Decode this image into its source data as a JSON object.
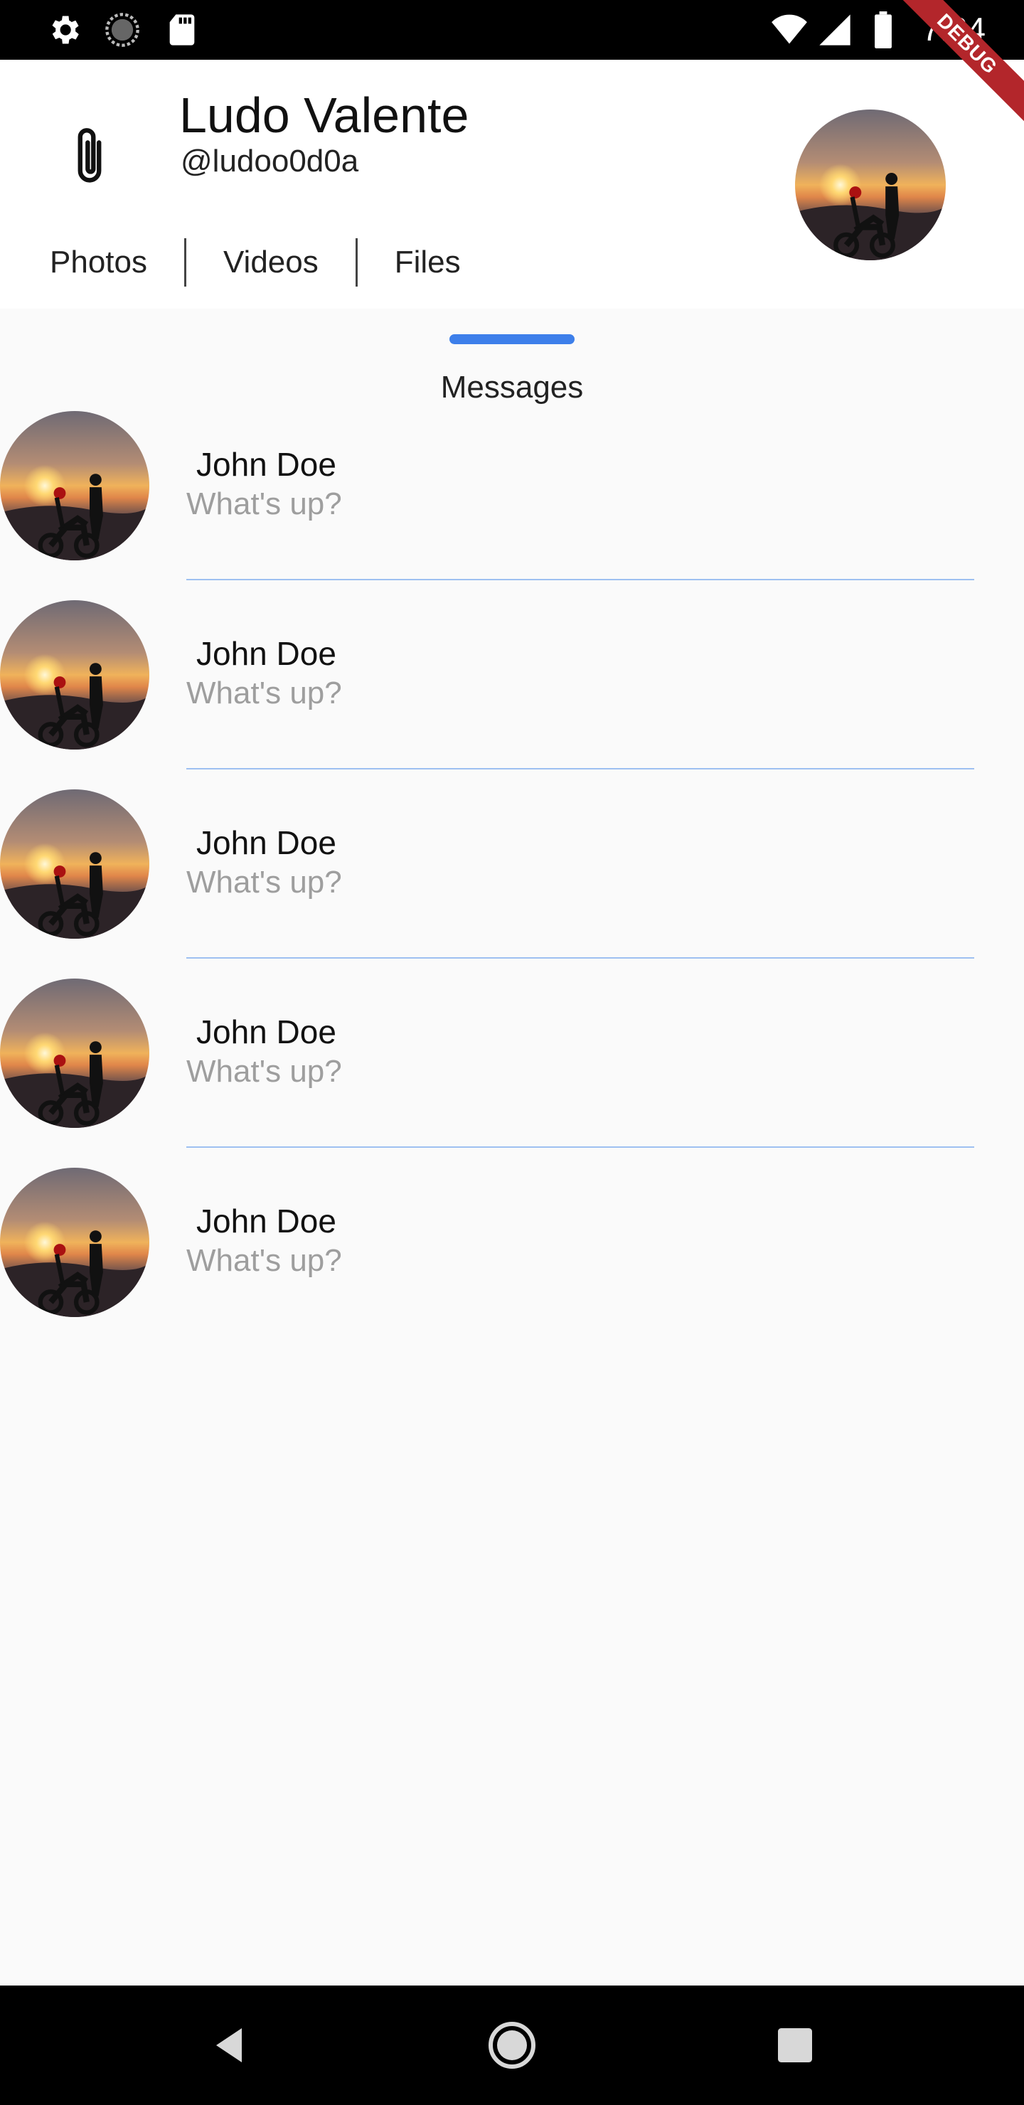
{
  "status_bar": {
    "time": "7:34",
    "left_icons": [
      "gear-icon",
      "loading-icon",
      "sd-card-icon"
    ],
    "right_icons": [
      "wifi-icon",
      "signal-icon",
      "battery-icon"
    ]
  },
  "debug_banner": "DEBUG",
  "header": {
    "name": "Ludo Valente",
    "handle": "@ludoo0d0a",
    "attach_icon": "paperclip-icon",
    "tabs": [
      {
        "label": "Photos"
      },
      {
        "label": "Videos"
      },
      {
        "label": "Files"
      }
    ]
  },
  "messages": {
    "title": "Messages",
    "items": [
      {
        "name": "John Doe",
        "preview": "What's up?"
      },
      {
        "name": "John Doe",
        "preview": "What's up?"
      },
      {
        "name": "John Doe",
        "preview": "What's up?"
      },
      {
        "name": "John Doe",
        "preview": "What's up?"
      },
      {
        "name": "John Doe",
        "preview": "What's up?"
      }
    ]
  },
  "colors": {
    "accent": "#3d7fea",
    "divider": "#9ec0f1",
    "preview_text": "#9e9e9e",
    "debug": "#b3262b"
  },
  "nav_bar": {
    "buttons": [
      "back-icon",
      "home-icon",
      "recents-icon"
    ]
  }
}
